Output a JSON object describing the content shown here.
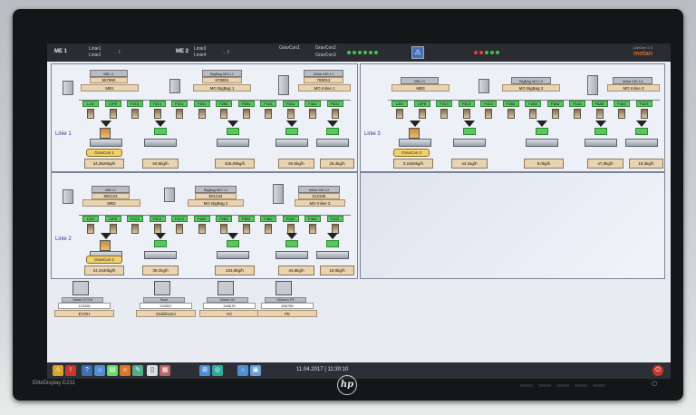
{
  "monitor": {
    "model": "EliteDisplay E231",
    "brand": "hp"
  },
  "topbar": {
    "me1": "ME 1",
    "linie1": "Linie1",
    "linie2": "Linie2",
    "me2": "ME 2",
    "linie3": "Linie3",
    "linie4": "Linie4",
    "grav1": "GravCon1",
    "grav2": "GravCon2",
    "grav3": "GravCon3",
    "ver": "LINKline 2.0",
    "logo": "motan"
  },
  "status_colors": {
    "ok": "#45c24a",
    "accent": "#d46a2a"
  },
  "line1": {
    "label": "Linie 1",
    "box_left": {
      "hdr": "MB L1",
      "value": "567890",
      "name": "MB1"
    },
    "box_mid": {
      "hdr": "BigBag MG L1",
      "value": "678901",
      "name": "MG BigBag 1"
    },
    "box_right": {
      "hdr": "Inline MG L1",
      "value": "789012",
      "name": "MG Inline 1"
    },
    "tags": [
      "L1IV",
      "L1PE",
      "F2C1",
      "F3C1",
      "F4C1",
      "F1B1",
      "F2B1",
      "F3B1",
      "F1A1",
      "F3A1",
      "F4A1",
      "F1D1"
    ],
    "dose": [
      "34,3526kg/h",
      "50,6kg/h",
      "336,08kg/h",
      "60,5kg/h",
      "25,4kg/h"
    ],
    "grav": "GravCon 1"
  },
  "line2": {
    "label": "Linie 2",
    "box_left": {
      "hdr": "MB L2",
      "value": "890123",
      "name": "MB2"
    },
    "box_mid": {
      "hdr": "BigBag MG L2",
      "value": "901234",
      "name": "MG BigBag 2"
    },
    "box_right": {
      "hdr": "Inline MG L2",
      "value": "012345",
      "name": "MG Inline 2"
    },
    "tags": [
      "L2IV",
      "L2PE",
      "F2C2",
      "F3C2",
      "F4C2",
      "F1B2",
      "F2B2",
      "F3B2",
      "F4B2",
      "F2A2",
      "F4A2",
      "F1D2"
    ],
    "dose": [
      "24,3440kg/h",
      "39,1kg/h",
      "224,8kg/h",
      "44,8kg/h",
      "18,5kg/h"
    ],
    "grav": "GravCon 2"
  },
  "line3": {
    "label": "Linie 3",
    "box_left": {
      "hdr": "MB L3",
      "value": "",
      "name": "MB3"
    },
    "box_mid": {
      "hdr": "BigBag MG L3",
      "value": "",
      "name": "MG BigBag 3"
    },
    "box_right": {
      "hdr": "Inline MG L3",
      "value": "",
      "name": "MG Inline 3"
    },
    "tags": [
      "L3IV",
      "L3PE",
      "F2C3",
      "F3C3",
      "F4C3",
      "F1B3",
      "F2B3",
      "F3B3",
      "F1A3",
      "F3A3",
      "F4A3",
      "F1D3"
    ],
    "dose": [
      "0,1826kg/h",
      "44,1kg/h",
      "8,0kg/h",
      "47,9kg/h",
      "19,3kg/h"
    ],
    "grav": "GravCon 3"
  },
  "bottom": [
    {
      "hdr": "Oktalin EVOH",
      "value": "123456",
      "name": "EVOH"
    },
    {
      "hdr": "Stufe",
      "value": "234567",
      "name": "Stabilisator"
    },
    {
      "hdr": "Oktalin HV",
      "value": "345678",
      "name": "HV"
    },
    {
      "hdr": "OKtamin PE",
      "value": "456789",
      "name": "PE"
    }
  ],
  "taskbar": {
    "datetime": "11.04.2017 | 11:30:10"
  }
}
